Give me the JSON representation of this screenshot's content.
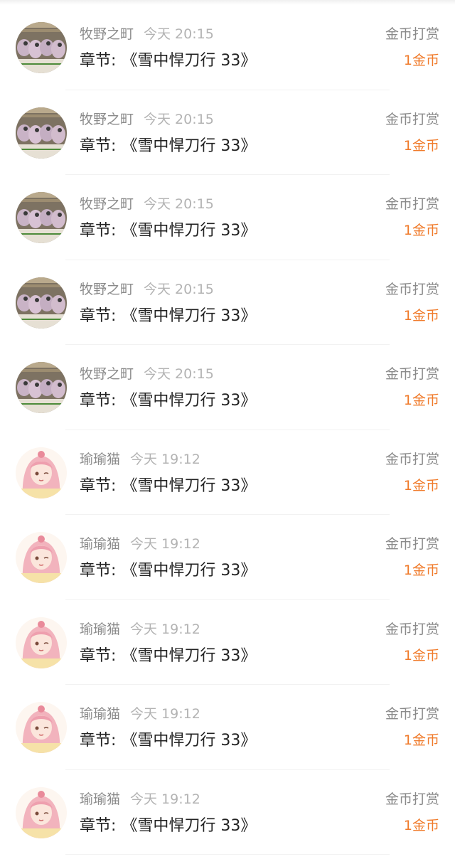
{
  "accent_color": "#f07a2a",
  "items": [
    {
      "user": "牧野之町",
      "time": "今天 20:15",
      "chapter_label": "章节:",
      "chapter_title": "《雪中悍刀行 33》",
      "reward_type": "金币打赏",
      "reward_amount": "1金币",
      "avatar": "cats-photo-avatar"
    },
    {
      "user": "牧野之町",
      "time": "今天 20:15",
      "chapter_label": "章节:",
      "chapter_title": "《雪中悍刀行 33》",
      "reward_type": "金币打赏",
      "reward_amount": "1金币",
      "avatar": "cats-photo-avatar"
    },
    {
      "user": "牧野之町",
      "time": "今天 20:15",
      "chapter_label": "章节:",
      "chapter_title": "《雪中悍刀行 33》",
      "reward_type": "金币打赏",
      "reward_amount": "1金币",
      "avatar": "cats-photo-avatar"
    },
    {
      "user": "牧野之町",
      "time": "今天 20:15",
      "chapter_label": "章节:",
      "chapter_title": "《雪中悍刀行 33》",
      "reward_type": "金币打赏",
      "reward_amount": "1金币",
      "avatar": "cats-photo-avatar"
    },
    {
      "user": "牧野之町",
      "time": "今天 20:15",
      "chapter_label": "章节:",
      "chapter_title": "《雪中悍刀行 33》",
      "reward_type": "金币打赏",
      "reward_amount": "1金币",
      "avatar": "cats-photo-avatar"
    },
    {
      "user": "瑜瑜猫",
      "time": "今天 19:12",
      "chapter_label": "章节:",
      "chapter_title": "《雪中悍刀行 33》",
      "reward_type": "金币打赏",
      "reward_amount": "1金币",
      "avatar": "anime-girl-avatar"
    },
    {
      "user": "瑜瑜猫",
      "time": "今天 19:12",
      "chapter_label": "章节:",
      "chapter_title": "《雪中悍刀行 33》",
      "reward_type": "金币打赏",
      "reward_amount": "1金币",
      "avatar": "anime-girl-avatar"
    },
    {
      "user": "瑜瑜猫",
      "time": "今天 19:12",
      "chapter_label": "章节:",
      "chapter_title": "《雪中悍刀行 33》",
      "reward_type": "金币打赏",
      "reward_amount": "1金币",
      "avatar": "anime-girl-avatar"
    },
    {
      "user": "瑜瑜猫",
      "time": "今天 19:12",
      "chapter_label": "章节:",
      "chapter_title": "《雪中悍刀行 33》",
      "reward_type": "金币打赏",
      "reward_amount": "1金币",
      "avatar": "anime-girl-avatar"
    },
    {
      "user": "瑜瑜猫",
      "time": "今天 19:12",
      "chapter_label": "章节:",
      "chapter_title": "《雪中悍刀行 33》",
      "reward_type": "金币打赏",
      "reward_amount": "1金币",
      "avatar": "anime-girl-avatar"
    }
  ]
}
